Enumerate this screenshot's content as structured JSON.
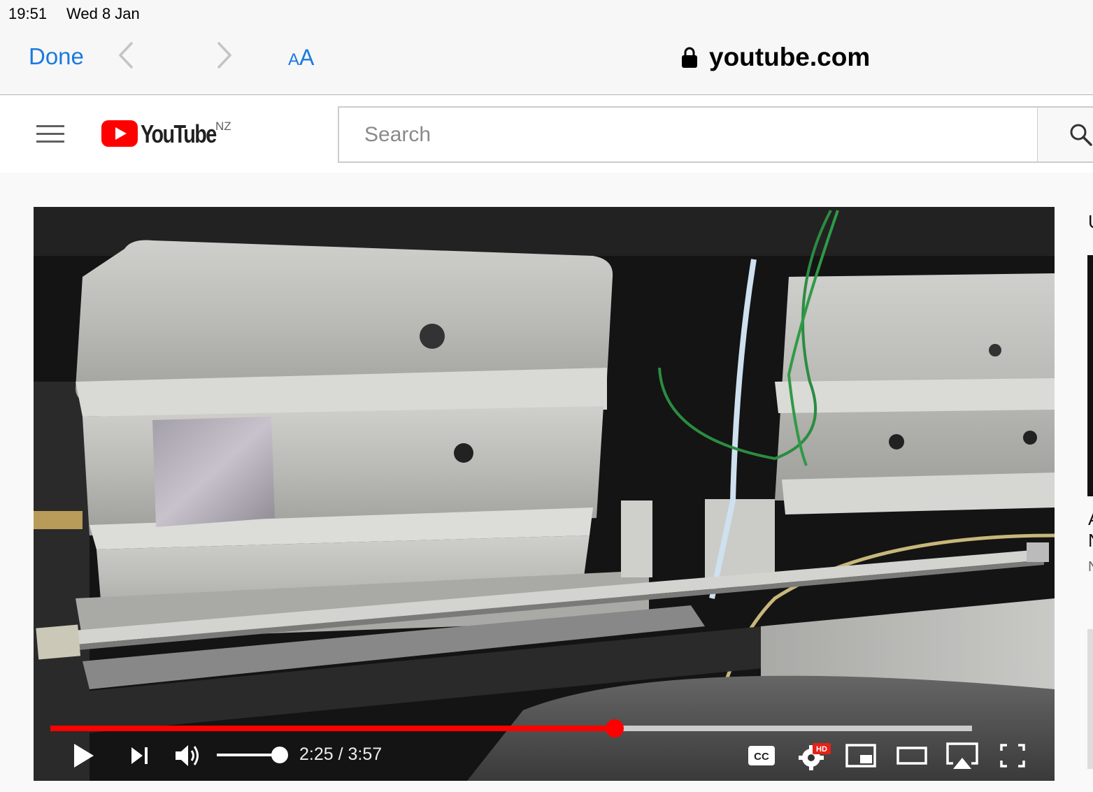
{
  "status_bar": {
    "time": "19:51",
    "date": "Wed 8 Jan"
  },
  "safari": {
    "done_label": "Done",
    "reader_small": "A",
    "reader_big": "A",
    "url": "youtube.com"
  },
  "youtube": {
    "logo_text": "YouTube",
    "region": "NZ",
    "search_placeholder": "Search"
  },
  "player": {
    "current_time": "2:25",
    "duration": "3:57",
    "time_text": "2:25 / 3:57",
    "progress_fraction": 0.612,
    "buffer_fraction": 1.0,
    "volume_fraction": 1.0,
    "hd_badge": "HD",
    "cc_label": "CC"
  },
  "sidebar_peek": {
    "chars": [
      "U",
      "A",
      "N",
      "N"
    ]
  },
  "colors": {
    "accent_blue": "#1a7ae0",
    "youtube_red": "#ff0000"
  }
}
